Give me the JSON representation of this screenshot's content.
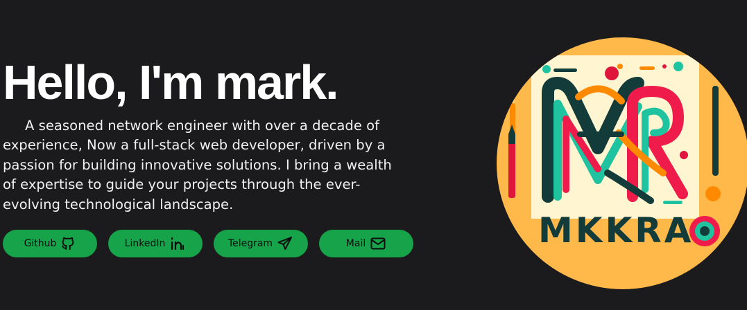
{
  "hero": {
    "title": "Hello, I'm mark.",
    "bio": "A seasoned network engineer with over a decade of experience, Now a full-stack web developer, driven by a passion for building innovative solutions. I bring a wealth of expertise to guide your projects through the ever-evolving technological landscape."
  },
  "links": [
    {
      "label": "Github",
      "icon": "github-icon"
    },
    {
      "label": "LinkedIn",
      "icon": "linkedin-icon"
    },
    {
      "label": "Telegram",
      "icon": "telegram-icon"
    },
    {
      "label": "Mail",
      "icon": "mail-icon"
    }
  ],
  "avatar": {
    "text": "MKKRA",
    "colors": {
      "background": "#ffb84a",
      "card": "#fff5d0",
      "teal": "#1fc3a0",
      "red": "#ef1c4b",
      "orange": "#ff8a00",
      "dark": "#123b3a"
    }
  },
  "colors": {
    "page_background": "#1b1b1d",
    "button": "#16a34a",
    "text": "#ffffff"
  }
}
